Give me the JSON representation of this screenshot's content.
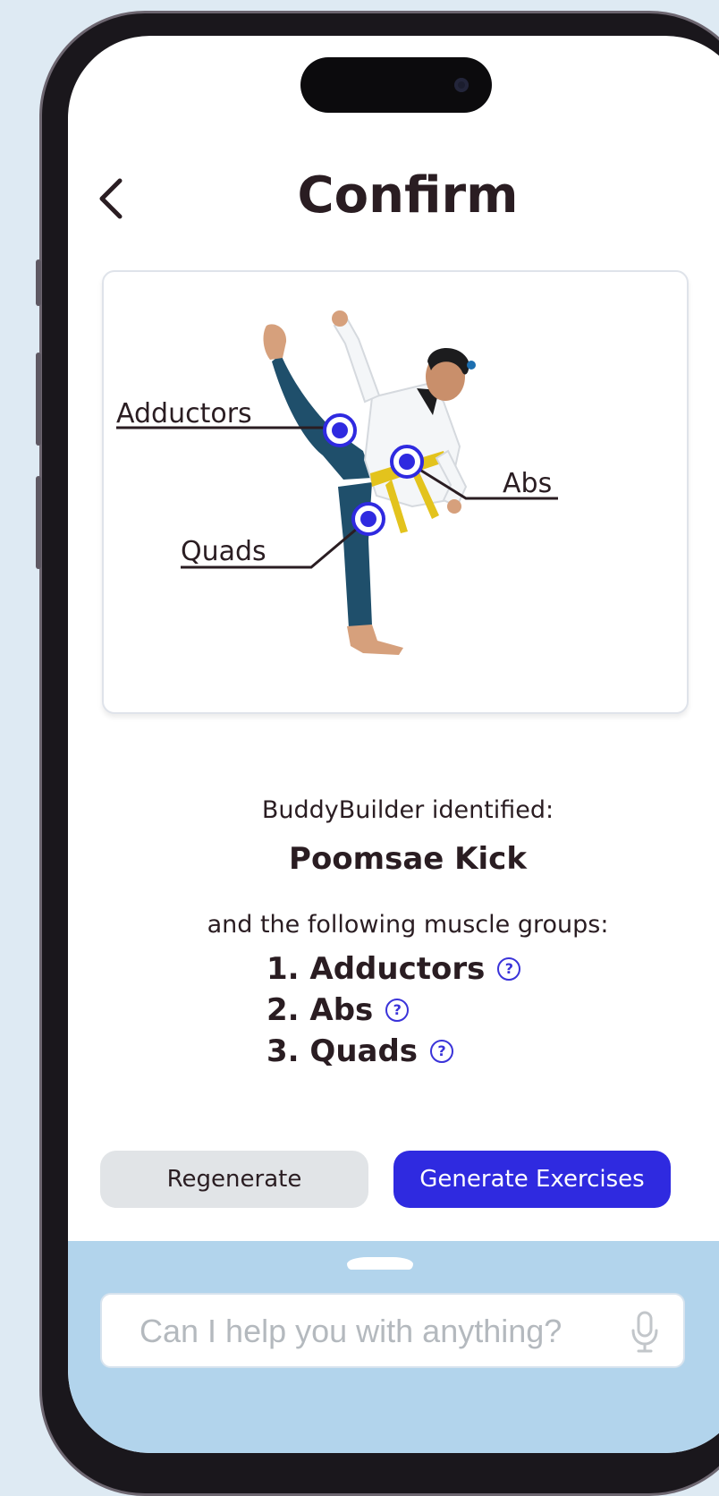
{
  "header": {
    "title": "Confirm"
  },
  "diagram": {
    "labels": {
      "adductors": "Adductors",
      "abs": "Abs",
      "quads": "Quads"
    }
  },
  "result": {
    "identified_label": "BuddyBuilder identified:",
    "exercise_name": "Poomsae Kick",
    "muscles_label": "and the following muscle groups:",
    "muscles": [
      "1. Adductors",
      "2. Abs",
      "3. Quads"
    ],
    "help_icon": "?"
  },
  "actions": {
    "regenerate": "Regenerate",
    "generate": "Generate Exercises"
  },
  "chat": {
    "placeholder": "Can I help you with anything?",
    "mic_icon": "microphone-icon"
  },
  "colors": {
    "accent": "#2f2ae0",
    "text": "#2a1d22",
    "secondary_button": "#e1e4e7",
    "chat_panel": "#b2d4ec",
    "page_background": "#deeaf3"
  }
}
